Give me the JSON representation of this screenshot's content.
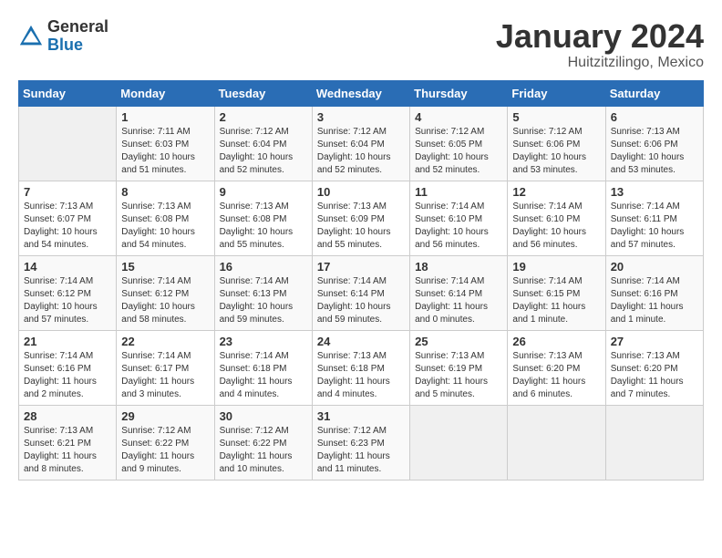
{
  "header": {
    "logo_general": "General",
    "logo_blue": "Blue",
    "month": "January 2024",
    "location": "Huitzitzilingo, Mexico"
  },
  "days_of_week": [
    "Sunday",
    "Monday",
    "Tuesday",
    "Wednesday",
    "Thursday",
    "Friday",
    "Saturday"
  ],
  "weeks": [
    [
      {
        "day": "",
        "sunrise": "",
        "sunset": "",
        "daylight": ""
      },
      {
        "day": "1",
        "sunrise": "Sunrise: 7:11 AM",
        "sunset": "Sunset: 6:03 PM",
        "daylight": "Daylight: 10 hours and 51 minutes."
      },
      {
        "day": "2",
        "sunrise": "Sunrise: 7:12 AM",
        "sunset": "Sunset: 6:04 PM",
        "daylight": "Daylight: 10 hours and 52 minutes."
      },
      {
        "day": "3",
        "sunrise": "Sunrise: 7:12 AM",
        "sunset": "Sunset: 6:04 PM",
        "daylight": "Daylight: 10 hours and 52 minutes."
      },
      {
        "day": "4",
        "sunrise": "Sunrise: 7:12 AM",
        "sunset": "Sunset: 6:05 PM",
        "daylight": "Daylight: 10 hours and 52 minutes."
      },
      {
        "day": "5",
        "sunrise": "Sunrise: 7:12 AM",
        "sunset": "Sunset: 6:06 PM",
        "daylight": "Daylight: 10 hours and 53 minutes."
      },
      {
        "day": "6",
        "sunrise": "Sunrise: 7:13 AM",
        "sunset": "Sunset: 6:06 PM",
        "daylight": "Daylight: 10 hours and 53 minutes."
      }
    ],
    [
      {
        "day": "7",
        "sunrise": "Sunrise: 7:13 AM",
        "sunset": "Sunset: 6:07 PM",
        "daylight": "Daylight: 10 hours and 54 minutes."
      },
      {
        "day": "8",
        "sunrise": "Sunrise: 7:13 AM",
        "sunset": "Sunset: 6:08 PM",
        "daylight": "Daylight: 10 hours and 54 minutes."
      },
      {
        "day": "9",
        "sunrise": "Sunrise: 7:13 AM",
        "sunset": "Sunset: 6:08 PM",
        "daylight": "Daylight: 10 hours and 55 minutes."
      },
      {
        "day": "10",
        "sunrise": "Sunrise: 7:13 AM",
        "sunset": "Sunset: 6:09 PM",
        "daylight": "Daylight: 10 hours and 55 minutes."
      },
      {
        "day": "11",
        "sunrise": "Sunrise: 7:14 AM",
        "sunset": "Sunset: 6:10 PM",
        "daylight": "Daylight: 10 hours and 56 minutes."
      },
      {
        "day": "12",
        "sunrise": "Sunrise: 7:14 AM",
        "sunset": "Sunset: 6:10 PM",
        "daylight": "Daylight: 10 hours and 56 minutes."
      },
      {
        "day": "13",
        "sunrise": "Sunrise: 7:14 AM",
        "sunset": "Sunset: 6:11 PM",
        "daylight": "Daylight: 10 hours and 57 minutes."
      }
    ],
    [
      {
        "day": "14",
        "sunrise": "Sunrise: 7:14 AM",
        "sunset": "Sunset: 6:12 PM",
        "daylight": "Daylight: 10 hours and 57 minutes."
      },
      {
        "day": "15",
        "sunrise": "Sunrise: 7:14 AM",
        "sunset": "Sunset: 6:12 PM",
        "daylight": "Daylight: 10 hours and 58 minutes."
      },
      {
        "day": "16",
        "sunrise": "Sunrise: 7:14 AM",
        "sunset": "Sunset: 6:13 PM",
        "daylight": "Daylight: 10 hours and 59 minutes."
      },
      {
        "day": "17",
        "sunrise": "Sunrise: 7:14 AM",
        "sunset": "Sunset: 6:14 PM",
        "daylight": "Daylight: 10 hours and 59 minutes."
      },
      {
        "day": "18",
        "sunrise": "Sunrise: 7:14 AM",
        "sunset": "Sunset: 6:14 PM",
        "daylight": "Daylight: 11 hours and 0 minutes."
      },
      {
        "day": "19",
        "sunrise": "Sunrise: 7:14 AM",
        "sunset": "Sunset: 6:15 PM",
        "daylight": "Daylight: 11 hours and 1 minute."
      },
      {
        "day": "20",
        "sunrise": "Sunrise: 7:14 AM",
        "sunset": "Sunset: 6:16 PM",
        "daylight": "Daylight: 11 hours and 1 minute."
      }
    ],
    [
      {
        "day": "21",
        "sunrise": "Sunrise: 7:14 AM",
        "sunset": "Sunset: 6:16 PM",
        "daylight": "Daylight: 11 hours and 2 minutes."
      },
      {
        "day": "22",
        "sunrise": "Sunrise: 7:14 AM",
        "sunset": "Sunset: 6:17 PM",
        "daylight": "Daylight: 11 hours and 3 minutes."
      },
      {
        "day": "23",
        "sunrise": "Sunrise: 7:14 AM",
        "sunset": "Sunset: 6:18 PM",
        "daylight": "Daylight: 11 hours and 4 minutes."
      },
      {
        "day": "24",
        "sunrise": "Sunrise: 7:13 AM",
        "sunset": "Sunset: 6:18 PM",
        "daylight": "Daylight: 11 hours and 4 minutes."
      },
      {
        "day": "25",
        "sunrise": "Sunrise: 7:13 AM",
        "sunset": "Sunset: 6:19 PM",
        "daylight": "Daylight: 11 hours and 5 minutes."
      },
      {
        "day": "26",
        "sunrise": "Sunrise: 7:13 AM",
        "sunset": "Sunset: 6:20 PM",
        "daylight": "Daylight: 11 hours and 6 minutes."
      },
      {
        "day": "27",
        "sunrise": "Sunrise: 7:13 AM",
        "sunset": "Sunset: 6:20 PM",
        "daylight": "Daylight: 11 hours and 7 minutes."
      }
    ],
    [
      {
        "day": "28",
        "sunrise": "Sunrise: 7:13 AM",
        "sunset": "Sunset: 6:21 PM",
        "daylight": "Daylight: 11 hours and 8 minutes."
      },
      {
        "day": "29",
        "sunrise": "Sunrise: 7:12 AM",
        "sunset": "Sunset: 6:22 PM",
        "daylight": "Daylight: 11 hours and 9 minutes."
      },
      {
        "day": "30",
        "sunrise": "Sunrise: 7:12 AM",
        "sunset": "Sunset: 6:22 PM",
        "daylight": "Daylight: 11 hours and 10 minutes."
      },
      {
        "day": "31",
        "sunrise": "Sunrise: 7:12 AM",
        "sunset": "Sunset: 6:23 PM",
        "daylight": "Daylight: 11 hours and 11 minutes."
      },
      {
        "day": "",
        "sunrise": "",
        "sunset": "",
        "daylight": ""
      },
      {
        "day": "",
        "sunrise": "",
        "sunset": "",
        "daylight": ""
      },
      {
        "day": "",
        "sunrise": "",
        "sunset": "",
        "daylight": ""
      }
    ]
  ]
}
